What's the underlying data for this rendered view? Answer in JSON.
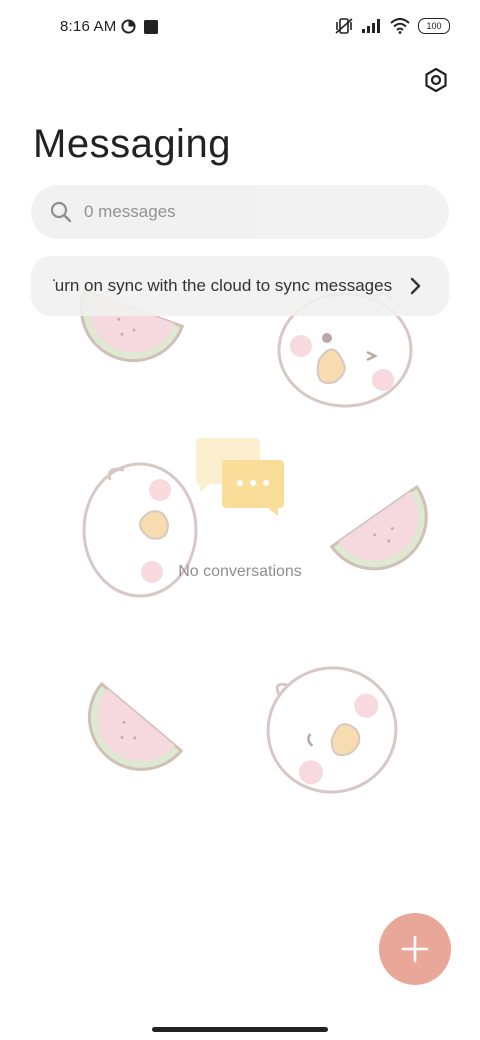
{
  "status_bar": {
    "time": "8:16 AM",
    "battery": "100",
    "icons": [
      "data-saver-icon",
      "square-notification-icon",
      "vibrate-icon",
      "signal-icon",
      "wifi-icon",
      "battery-icon"
    ]
  },
  "header": {
    "title": "Messaging",
    "settings_icon": "settings-hex-icon"
  },
  "search": {
    "placeholder": "0 messages",
    "icon": "search-icon"
  },
  "sync_banner": {
    "text": "Turn on sync with the cloud to sync messages",
    "icon": "chevron-right-icon"
  },
  "empty_state": {
    "icon": "chat-bubbles-icon",
    "text": "No conversations"
  },
  "fab": {
    "icon": "plus-icon",
    "color": "#e9a79a"
  },
  "colors": {
    "accent": "#e9a79a",
    "search_bg": "#f1f1f1",
    "chat_icon": "#f6d58c"
  }
}
